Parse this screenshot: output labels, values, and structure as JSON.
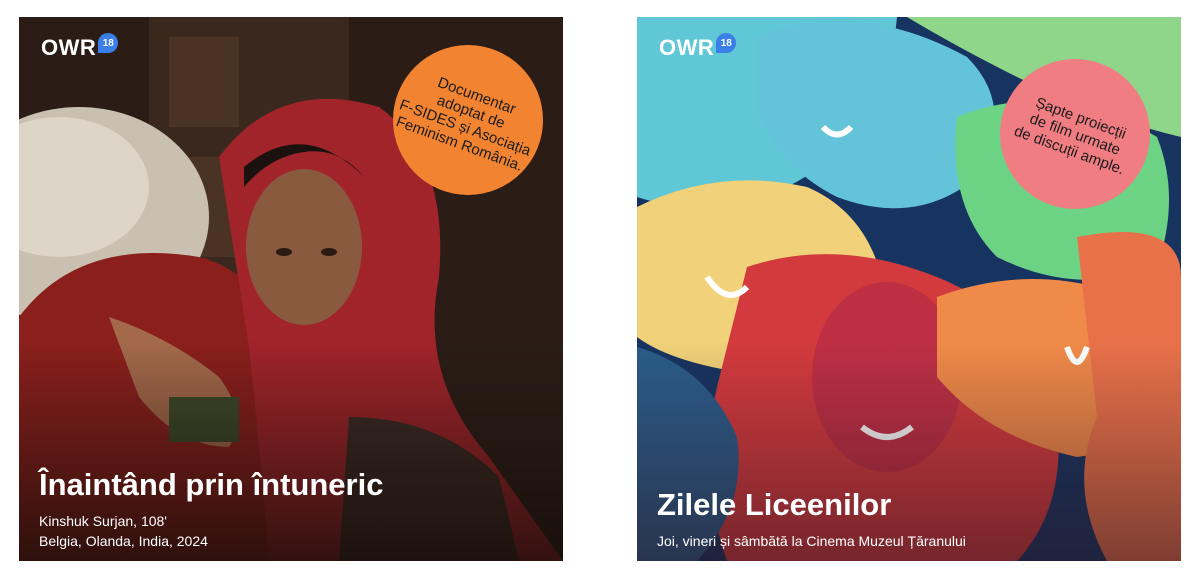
{
  "cards": [
    {
      "brand": {
        "name": "OWR",
        "badge": "18"
      },
      "badge_text": "Documentar\nadoptat de\nF-SIDES și Asociația\nFeminism România.",
      "title": "Înaintând prin întuneric",
      "subtitle_line1": "Kinshuk Surjan, 108'",
      "subtitle_line2": "Belgia, Olanda, India, 2024",
      "image": "photo of woman in red headscarf embracing child"
    },
    {
      "brand": {
        "name": "OWR",
        "badge": "18"
      },
      "badge_text": "Șapte proiecții\nde film urmate\nde discuții ample.",
      "title": "Zilele Liceenilor",
      "subtitle_line1": "Joi, vineri și sâmbătă la Cinema Muzeul Țăranului",
      "image": "illustration of colorful smiling faces"
    }
  ],
  "colors": {
    "brand_badge": "#3a7ee8",
    "badge1": "#f28431",
    "badge2": "#f07d82"
  }
}
